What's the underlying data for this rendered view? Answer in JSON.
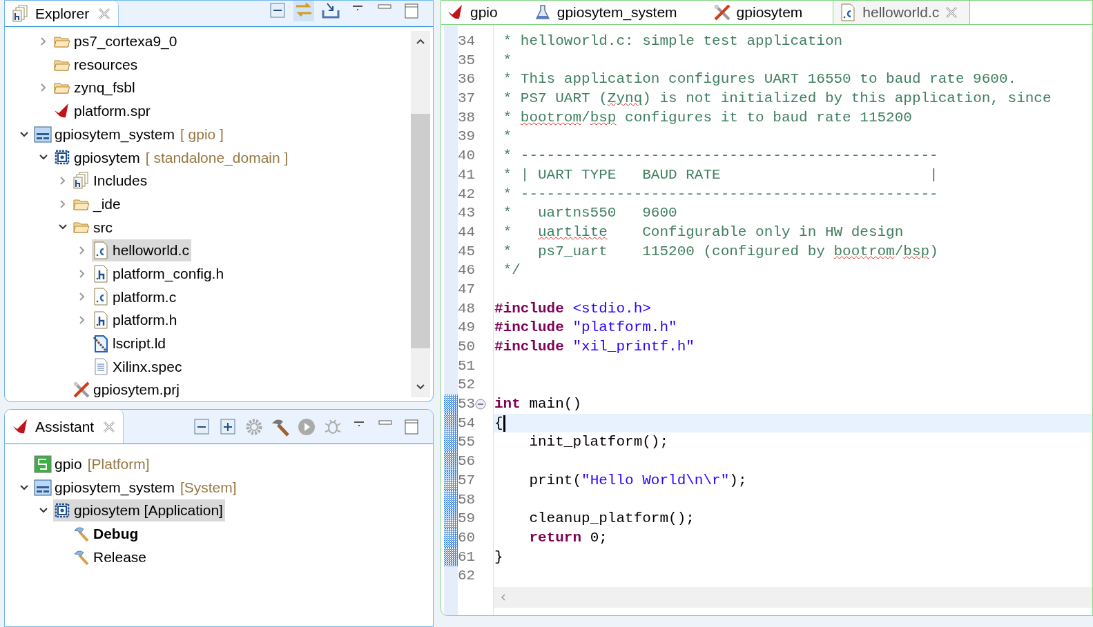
{
  "explorer": {
    "tab": {
      "label": "Explorer",
      "selected": true
    },
    "tree": [
      {
        "children": [
          {
            "label": "ps7_cortexa9_0",
            "kind": "folder",
            "expanded": false,
            "selected": false
          },
          {
            "label": "resources",
            "kind": "folder",
            "selected": false
          },
          {
            "label": "zynq_fsbl",
            "kind": "folder",
            "expanded": false,
            "selected": false
          },
          {
            "label": "platform.spr",
            "kind": "spr",
            "selected": false
          }
        ]
      },
      {
        "label": "gpiosytem_system",
        "suffix": "[ gpio ]",
        "kind": "system",
        "expanded": true,
        "selected": false,
        "children": [
          {
            "label": "gpiosytem",
            "suffix": "[ standalone_domain ]",
            "kind": "app",
            "expanded": true,
            "selected": false,
            "children": [
              {
                "label": "Includes",
                "kind": "includes",
                "expanded": false,
                "selected": false
              },
              {
                "label": "_ide",
                "kind": "folder",
                "expanded": false,
                "selected": false
              },
              {
                "label": "src",
                "kind": "folder",
                "expanded": true,
                "selected": false,
                "children": [
                  {
                    "label": "helloworld.c",
                    "kind": "c",
                    "expanded": false,
                    "selected": true
                  },
                  {
                    "label": "platform_config.h",
                    "kind": "h",
                    "expanded": false,
                    "selected": false
                  },
                  {
                    "label": "platform.c",
                    "kind": "c",
                    "expanded": false,
                    "selected": false
                  },
                  {
                    "label": "platform.h",
                    "kind": "h",
                    "expanded": false,
                    "selected": false
                  },
                  {
                    "label": "lscript.ld",
                    "kind": "ld",
                    "selected": false
                  },
                  {
                    "label": "Xilinx.spec",
                    "kind": "text",
                    "selected": false
                  }
                ]
              },
              {
                "label": "gpiosytem.prj",
                "kind": "prj",
                "selected": false
              }
            ]
          }
        ]
      }
    ]
  },
  "assistant": {
    "tab": {
      "label": "Assistant",
      "selected": true
    },
    "tree": [
      {
        "label": "gpio",
        "suffix": "[Platform]",
        "kind": "platform",
        "selected": false
      },
      {
        "label": "gpiosytem_system",
        "suffix": "[System]",
        "kind": "system",
        "expanded": true,
        "selected": false,
        "children": [
          {
            "label": "gpiosytem [Application]",
            "kind": "app",
            "expanded": true,
            "selected": true,
            "children": [
              {
                "label": "Debug",
                "kind": "hammer",
                "active": true,
                "selected": false
              },
              {
                "label": "Release",
                "kind": "hammer",
                "active": false,
                "selected": false
              }
            ]
          }
        ]
      }
    ]
  },
  "editor": {
    "tabs": [
      {
        "label": "gpio",
        "kind": "spr",
        "selected": false
      },
      {
        "label": "gpiosytem_system",
        "kind": "flask",
        "selected": false
      },
      {
        "label": "gpiosytem",
        "kind": "prj",
        "selected": false
      },
      {
        "label": "helloworld.c",
        "kind": "c",
        "selected": true
      }
    ],
    "lines": [
      {
        "n": "34",
        "tokens": [
          {
            "kind": "comment",
            "t": " * helloworld.c: simple test application"
          }
        ]
      },
      {
        "n": "35",
        "tokens": [
          {
            "kind": "comment",
            "t": " *"
          }
        ]
      },
      {
        "n": "36",
        "tokens": [
          {
            "kind": "comment",
            "t": " * This application configures UART 16550 to baud rate 9600."
          }
        ]
      },
      {
        "n": "37",
        "tokens": [
          {
            "kind": "comment",
            "t": " * PS7 UART ("
          },
          {
            "kind": "typo",
            "t": "Zynq"
          },
          {
            "kind": "comment",
            "t": ") is not initialized by this application, since"
          }
        ]
      },
      {
        "n": "38",
        "tokens": [
          {
            "kind": "comment",
            "t": " * "
          },
          {
            "kind": "typo",
            "t": "bootrom"
          },
          {
            "kind": "comment",
            "t": "/"
          },
          {
            "kind": "typo",
            "t": "bsp"
          },
          {
            "kind": "comment",
            "t": " configures it to baud rate 115200"
          }
        ]
      },
      {
        "n": "39",
        "tokens": [
          {
            "kind": "comment",
            "t": " *"
          }
        ]
      },
      {
        "n": "40",
        "tokens": [
          {
            "kind": "comment",
            "t": " * ------------------------------------------------"
          }
        ]
      },
      {
        "n": "41",
        "tokens": [
          {
            "kind": "comment",
            "t": " * | UART TYPE   BAUD RATE                        |"
          }
        ]
      },
      {
        "n": "42",
        "tokens": [
          {
            "kind": "comment",
            "t": " * ------------------------------------------------"
          }
        ]
      },
      {
        "n": "43",
        "tokens": [
          {
            "kind": "comment",
            "t": " *   uartns550   9600"
          }
        ]
      },
      {
        "n": "44",
        "tokens": [
          {
            "kind": "comment",
            "t": " *   "
          },
          {
            "kind": "typo",
            "t": "uartlite"
          },
          {
            "kind": "comment",
            "t": "    Configurable only in HW design"
          }
        ]
      },
      {
        "n": "45",
        "tokens": [
          {
            "kind": "comment",
            "t": " *   ps7_uart    115200 (configured by "
          },
          {
            "kind": "typo",
            "t": "bootrom"
          },
          {
            "kind": "comment",
            "t": "/"
          },
          {
            "kind": "typo",
            "t": "bsp"
          },
          {
            "kind": "comment",
            "t": ")"
          }
        ]
      },
      {
        "n": "46",
        "tokens": [
          {
            "kind": "comment",
            "t": " */"
          }
        ]
      },
      {
        "n": "47"
      },
      {
        "n": "48",
        "tokens": [
          {
            "kind": "keyword",
            "t": "#include"
          },
          {
            "kind": "string",
            "t": " <stdio.h>"
          }
        ]
      },
      {
        "n": "49",
        "tokens": [
          {
            "kind": "keyword",
            "t": "#include"
          },
          {
            "kind": "string",
            "t": " \"platform.h\""
          }
        ]
      },
      {
        "n": "50",
        "tokens": [
          {
            "kind": "keyword",
            "t": "#include"
          },
          {
            "kind": "string",
            "t": " \"xil_printf.h\""
          }
        ]
      },
      {
        "n": "51"
      },
      {
        "n": "52"
      },
      {
        "n": "53",
        "fold": true,
        "changed": true,
        "tokens": [
          {
            "kind": "keyword",
            "t": "int"
          },
          {
            "kind": "plain",
            "t": " main()"
          }
        ]
      },
      {
        "n": "54",
        "changed": true,
        "current": true,
        "tokens": [
          {
            "kind": "plain",
            "t": "{"
          }
        ]
      },
      {
        "n": "55",
        "changed": true,
        "tokens": [
          {
            "kind": "plain",
            "t": "    init_platform();"
          }
        ]
      },
      {
        "n": "56",
        "changed": true
      },
      {
        "n": "57",
        "changed": true,
        "tokens": [
          {
            "kind": "plain",
            "t": "    print("
          },
          {
            "kind": "string",
            "t": "\"Hello World\\n\\r\""
          },
          {
            "kind": "plain",
            "t": ");"
          }
        ]
      },
      {
        "n": "58",
        "changed": true
      },
      {
        "n": "59",
        "changed": true,
        "tokens": [
          {
            "kind": "plain",
            "t": "    cleanup_platform();"
          }
        ]
      },
      {
        "n": "60",
        "changed": true,
        "tokens": [
          {
            "kind": "keyword",
            "t": "    return"
          },
          {
            "kind": "plain",
            "t": " 0;"
          }
        ]
      },
      {
        "n": "61",
        "changed": true,
        "tokens": [
          {
            "kind": "plain",
            "t": "}"
          }
        ]
      },
      {
        "n": "62"
      }
    ]
  }
}
